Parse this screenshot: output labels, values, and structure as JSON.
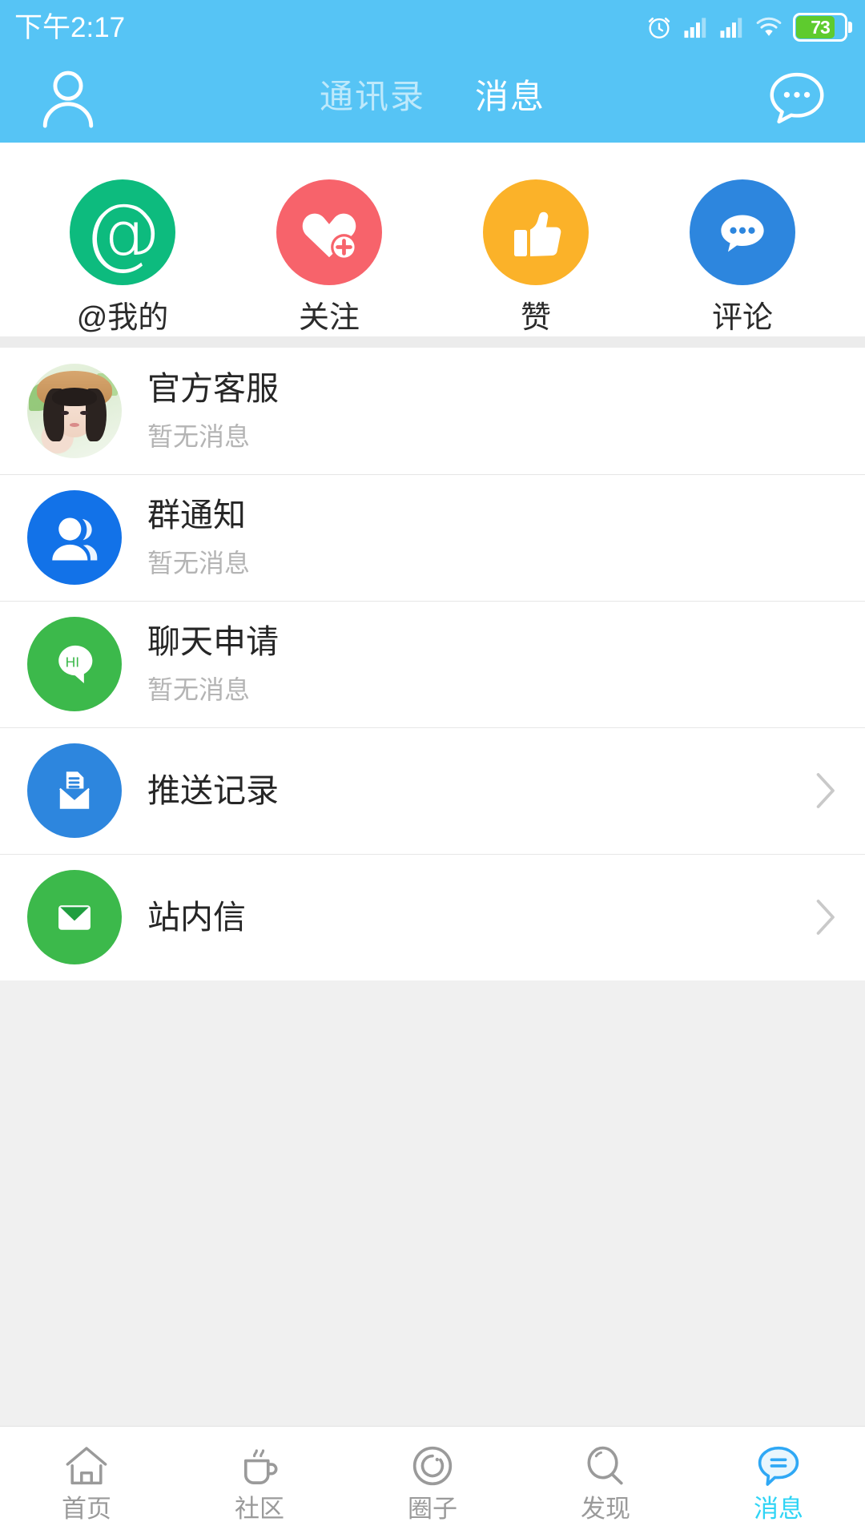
{
  "theme": {
    "header_bg": "#56c4f5",
    "active_tab_color": "#2fd4f5",
    "page_bg": "#f0f0f0",
    "card_bg": "#ffffff",
    "divider": "#e6e6e6"
  },
  "statusbar": {
    "time": "下午2:17",
    "battery_level": "73",
    "icons": [
      "alarm-icon",
      "signal-bars-icon",
      "signal-bars-icon",
      "wifi-icon",
      "battery-icon"
    ]
  },
  "header": {
    "profile_icon": "person-icon",
    "compose_icon": "chat-bubble-icon",
    "tabs": [
      {
        "label": "通讯录",
        "active": false
      },
      {
        "label": "消息",
        "active": true
      }
    ]
  },
  "quick_actions": [
    {
      "label": "@我的",
      "icon": "at-sign-icon",
      "color": "#0dbb7e"
    },
    {
      "label": "关注",
      "icon": "heart-plus-icon",
      "color": "#f7636b"
    },
    {
      "label": "赞",
      "icon": "thumbs-up-icon",
      "color": "#fbb229"
    },
    {
      "label": "评论",
      "icon": "comment-dots-icon",
      "color": "#2d86de"
    }
  ],
  "message_list": [
    {
      "title": "官方客服",
      "subtitle": "暂无消息",
      "avatar": "photo-avatar",
      "avatar_color": "",
      "chevron": false
    },
    {
      "title": "群通知",
      "subtitle": "暂无消息",
      "avatar": "group-users-icon",
      "avatar_color": "#1272e8",
      "chevron": false
    },
    {
      "title": "聊天申请",
      "subtitle": "暂无消息",
      "avatar": "hi-bubble-icon",
      "avatar_color": "#3cb94b",
      "avatar_text": "HI",
      "chevron": false
    },
    {
      "title": "推送记录",
      "subtitle": "",
      "avatar": "inbox-document-icon",
      "avatar_color": "#2d86de",
      "chevron": true
    },
    {
      "title": "站内信",
      "subtitle": "",
      "avatar": "envelope-icon",
      "avatar_color": "#3cb94b",
      "chevron": true
    }
  ],
  "bottom_nav": [
    {
      "label": "首页",
      "icon": "home-icon",
      "active": false
    },
    {
      "label": "社区",
      "icon": "coffee-cup-icon",
      "active": false
    },
    {
      "label": "圈子",
      "icon": "circle-icon",
      "active": false
    },
    {
      "label": "发现",
      "icon": "search-icon",
      "active": false
    },
    {
      "label": "消息",
      "icon": "message-icon",
      "active": true
    }
  ]
}
